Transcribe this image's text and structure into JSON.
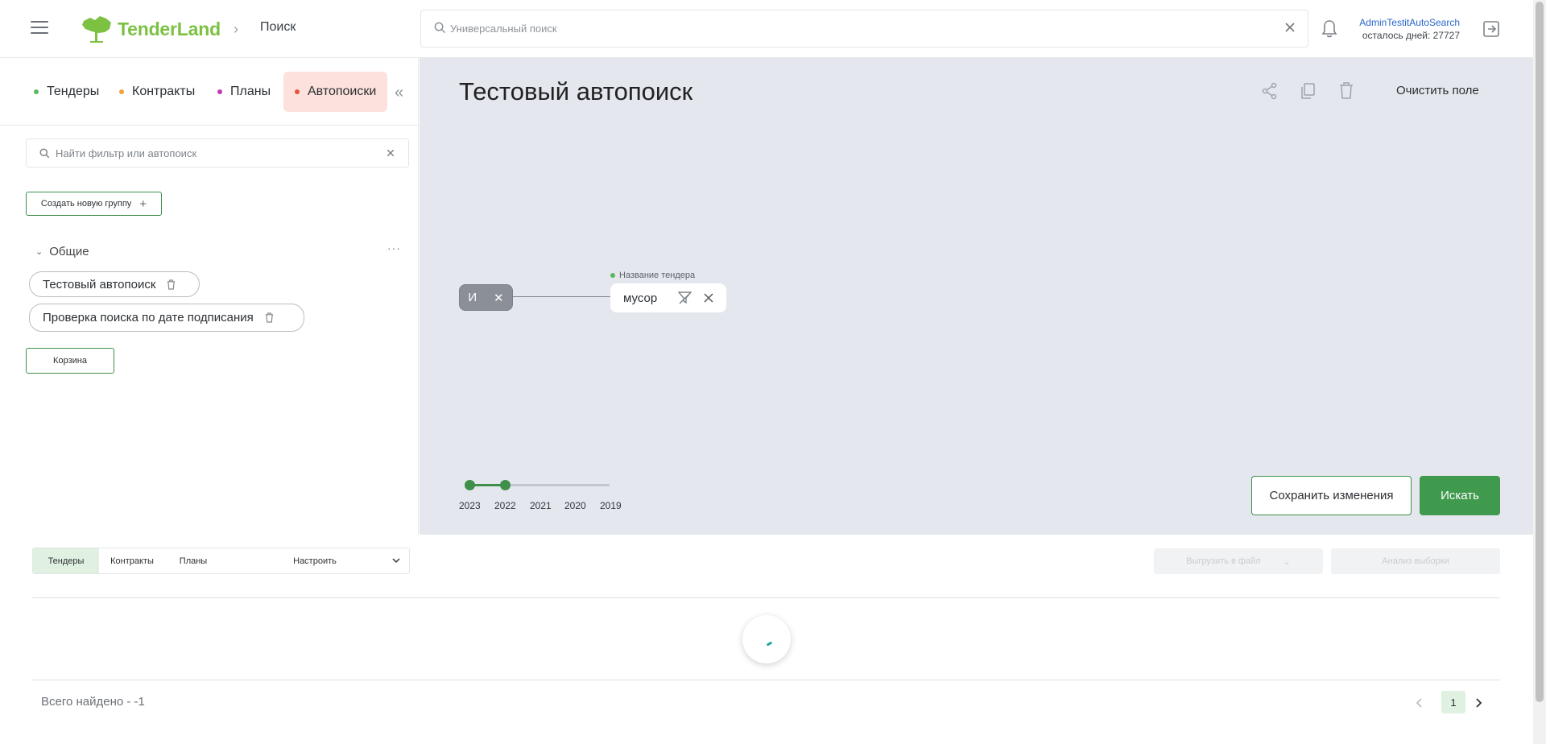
{
  "header": {
    "logo_text": "TenderLand",
    "breadcrumb": "Поиск",
    "search_placeholder": "Универсальный поиск",
    "user_name": "AdminTestitAutoSearch",
    "days_left": "осталось дней: 27727"
  },
  "left": {
    "tabs": [
      {
        "label": "Тендеры",
        "color": "#5cb85c"
      },
      {
        "label": "Контракты",
        "color": "#f0a33a"
      },
      {
        "label": "Планы",
        "color": "#c43bb3"
      },
      {
        "label": "Автопоиски",
        "color": "#e8533f"
      }
    ],
    "filter_placeholder": "Найти фильтр или автопоиск",
    "create_group_label": "Создать новую группу",
    "group_name": "Общие",
    "items": [
      "Тестовый автопоиск",
      "Проверка поиска по дате подписания"
    ],
    "trash_label": "Корзина"
  },
  "canvas": {
    "title": "Тестовый автопоиск",
    "clear_label": "Очистить поле",
    "operator_label": "И",
    "field_label": "Название тендера",
    "term": "мусор",
    "years": [
      "2023",
      "2022",
      "2021",
      "2020",
      "2019"
    ],
    "save_label": "Сохранить изменения",
    "search_label": "Искать"
  },
  "results": {
    "tabs": [
      "Тендеры",
      "Контракты",
      "Планы",
      "Настроить"
    ],
    "export_label": "Выгрузить в файл",
    "analysis_label": "Анализ выборки",
    "total_label": "Всего найдено - -1",
    "current_page": "1"
  }
}
